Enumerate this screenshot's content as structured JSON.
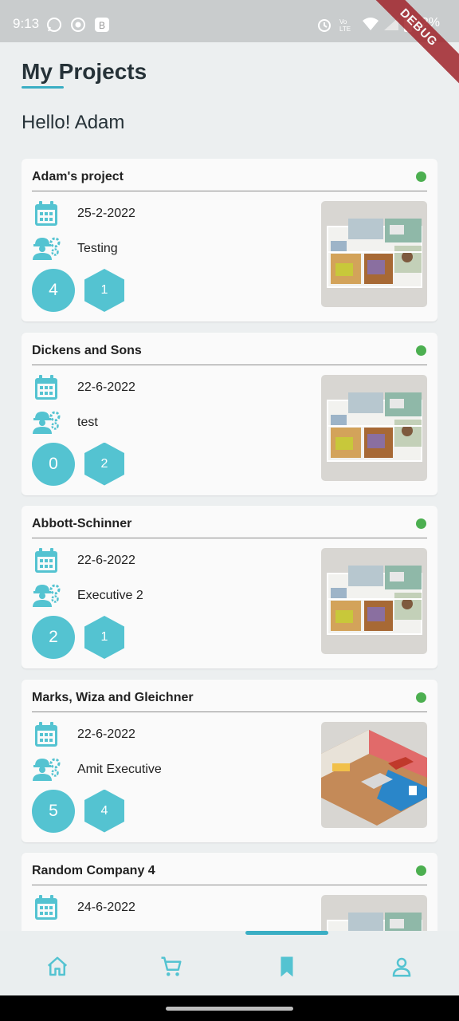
{
  "status_bar": {
    "time": "9:13",
    "battery": "52%",
    "signal_text": "4G",
    "debug_label": "DEBUG"
  },
  "header": {
    "title": "My Projects",
    "greeting": "Hello! Adam"
  },
  "colors": {
    "accent": "#54c3d1",
    "status_active": "#4caf50",
    "background": "#eceff0"
  },
  "projects": [
    {
      "name": "Adam's project",
      "date": "25-2-2022",
      "executive": "Testing",
      "count_a": "4",
      "count_b": "1",
      "image": "floorplan"
    },
    {
      "name": "Dickens and Sons",
      "date": "22-6-2022",
      "executive": "test",
      "count_a": "0",
      "count_b": "2",
      "image": "floorplan"
    },
    {
      "name": "Abbott-Schinner",
      "date": "22-6-2022",
      "executive": "Executive 2",
      "count_a": "2",
      "count_b": "1",
      "image": "floorplan"
    },
    {
      "name": "Marks, Wiza and Gleichner",
      "date": "22-6-2022",
      "executive": "Amit Executive",
      "count_a": "5",
      "count_b": "4",
      "image": "isometric-house"
    },
    {
      "name": "Random Company 4",
      "date": "24-6-2022",
      "executive": "",
      "count_a": "",
      "count_b": "",
      "image": "floorplan"
    }
  ],
  "bottom_nav": {
    "items": [
      {
        "name": "home",
        "icon": "home-icon"
      },
      {
        "name": "cart",
        "icon": "cart-icon"
      },
      {
        "name": "saved",
        "icon": "bookmark-icon",
        "selected": true
      },
      {
        "name": "profile",
        "icon": "person-icon"
      }
    ]
  }
}
